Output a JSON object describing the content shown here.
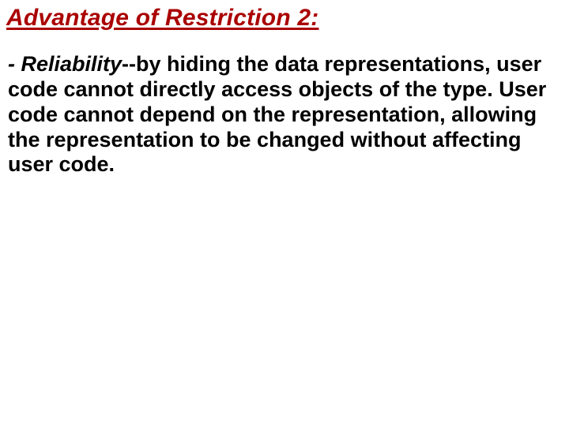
{
  "title": "Advantage of Restriction 2:",
  "body": {
    "lead_space": " ",
    "lead_dash": "- ",
    "term": "Reliability",
    "rest": "--by hiding the data representations, user code cannot directly access objects of the  type.  User code cannot depend on the representation, allowing the representation to be changed without affecting user code."
  }
}
